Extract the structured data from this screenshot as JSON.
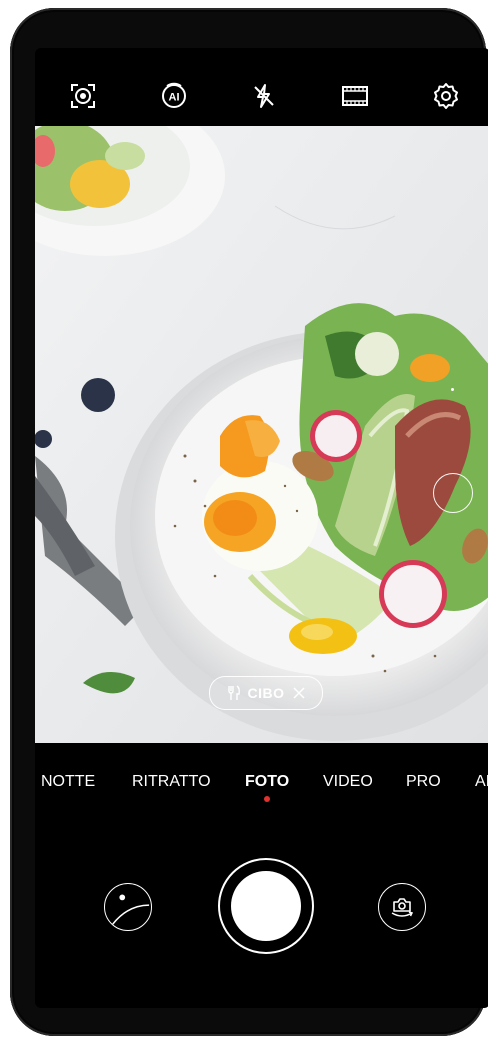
{
  "toolbar": {
    "icons": [
      "aperture-icon",
      "ai-icon",
      "flash-off-icon",
      "video-aspect-icon",
      "settings-icon"
    ],
    "ai_text": "AI"
  },
  "viewfinder": {
    "scene_chip": {
      "icon": "cutlery-icon",
      "label": "CIBO",
      "close_icon": "close-icon"
    }
  },
  "modes": {
    "items": [
      "NOTTE",
      "RITRATTO",
      "FOTO",
      "VIDEO",
      "PRO",
      "AI"
    ],
    "active": "FOTO",
    "indicator_color": "#e0322f"
  },
  "controls": {
    "gallery_icon": "gallery-thumbnail",
    "shutter_icon": "shutter-button",
    "switch_icon": "switch-camera-icon"
  },
  "colors": {
    "background": "#000000",
    "text": "#ffffff",
    "accent": "#e0322f"
  }
}
